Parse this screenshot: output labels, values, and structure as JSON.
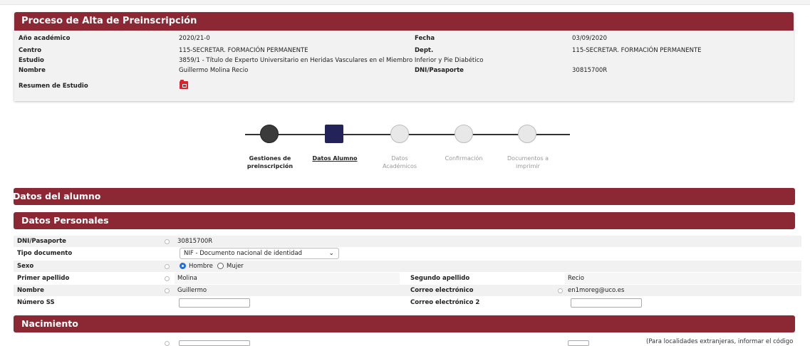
{
  "header": {
    "title": "Proceso de Alta de Preinscripción",
    "rows": {
      "anio_label": "Año académico",
      "anio_value": "2020/21-0",
      "fecha_label": "Fecha",
      "fecha_value": "03/09/2020",
      "centro_label": "Centro",
      "centro_value": "115-SECRETAR. FORMACIÓN PERMANENTE",
      "dept_label": "Dept.",
      "dept_value": "115-SECRETAR. FORMACIÓN PERMANENTE",
      "estudio_label": "Estudio",
      "estudio_value": "3859/1 - Título de Experto Universitario en Heridas Vasculares en el Miembro Inferior y Pie Diabético",
      "nombre_label": "Nombre",
      "nombre_value": "Guillermo Molina Recio",
      "dni_label": "DNI/Pasaporte",
      "dni_value": "30815700R",
      "resumen_label": "Resumen de Estudio"
    }
  },
  "stepper": {
    "steps": [
      {
        "line1": "Gestiones de",
        "line2": "preinscripción",
        "state": "done"
      },
      {
        "line1": "Datos Alumno",
        "line2": "",
        "state": "current"
      },
      {
        "line1": "Datos",
        "line2": "Académicos",
        "state": "future"
      },
      {
        "line1": "Confirmación",
        "line2": "",
        "state": "future"
      },
      {
        "line1": "Documentos a",
        "line2": "imprimir",
        "state": "future"
      }
    ]
  },
  "sections": {
    "alumno": "Datos del alumno",
    "personales": "Datos Personales",
    "nacimiento": "Nacimiento"
  },
  "form": {
    "dni_label": "DNI/Pasaporte",
    "dni_value": "30815700R",
    "tipo_label": "Tipo documento",
    "tipo_value": "NIF - Documento nacional de identidad",
    "sexo_label": "Sexo",
    "sexo_hombre": "Hombre",
    "sexo_mujer": "Mujer",
    "ap1_label": "Primer apellido",
    "ap1_value": "Molina",
    "ap2_label": "Segundo apellido",
    "ap2_value": "Recio",
    "nombre_label": "Nombre",
    "nombre_value": "Guillermo",
    "correo_label": "Correo electrónico",
    "correo_value": "en1moreg@uco.es",
    "ss_label": "Número SS",
    "ss_value": "",
    "correo2_label": "Correo electrónico 2",
    "correo2_value": ""
  },
  "footer_note": "(Para localidades extranjeras, informar el código"
}
